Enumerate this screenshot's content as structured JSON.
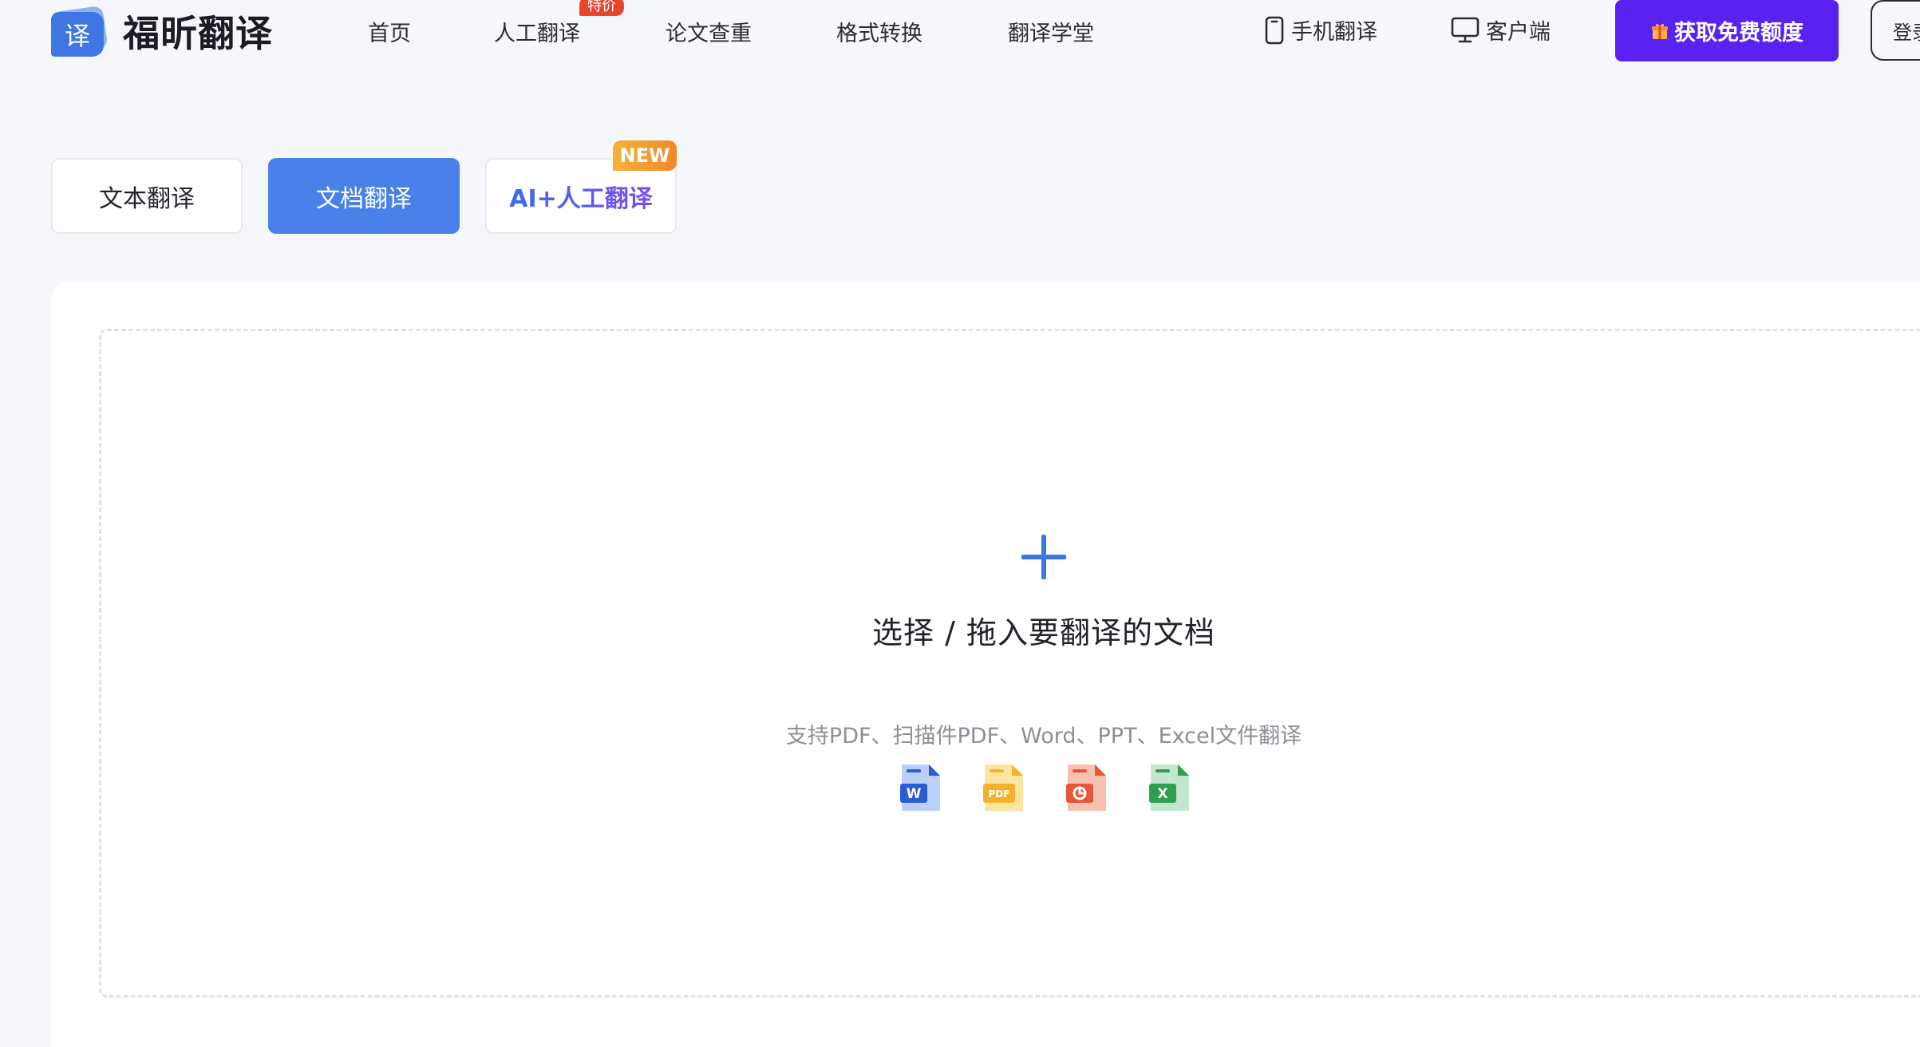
{
  "header": {
    "logo": {
      "mark_char": "译",
      "text": "福昕翻译"
    },
    "nav": [
      {
        "label": "首页"
      },
      {
        "label": "人工翻译",
        "badge": "特价"
      },
      {
        "label": "论文查重"
      },
      {
        "label": "格式转换"
      },
      {
        "label": "翻译学堂"
      }
    ],
    "right_links": [
      {
        "label": "手机翻译",
        "icon": "mobile-phone-icon"
      },
      {
        "label": "客户端",
        "icon": "monitor-icon"
      }
    ],
    "cta_label": "获取免费额度",
    "cta_icon": "gift-icon",
    "login_label": "登录"
  },
  "mode_tabs": [
    {
      "label": "文本翻译",
      "active": false
    },
    {
      "label": "文档翻译",
      "active": true
    },
    {
      "label": "AI+人工翻译",
      "active": false,
      "badge": "NEW"
    }
  ],
  "upload": {
    "title": "选择 / 拖入要翻译的文档",
    "subtitle": "支持PDF、扫描件PDF、Word、PPT、Excel文件翻译",
    "file_types": [
      {
        "icon": "word-file-icon",
        "letter": "W"
      },
      {
        "icon": "pdf-file-icon",
        "letter": "PDF"
      },
      {
        "icon": "ppt-file-icon",
        "letter": "P"
      },
      {
        "icon": "excel-file-icon",
        "letter": "X"
      }
    ]
  },
  "colors": {
    "brand_blue": "#3f76e3",
    "tab_active": "#4a80ea",
    "cta_purple": "#5a22f0",
    "hot_badge": "#e8452f",
    "new_badge": "#f08a2a",
    "page_bg": "#f6f7fb"
  }
}
